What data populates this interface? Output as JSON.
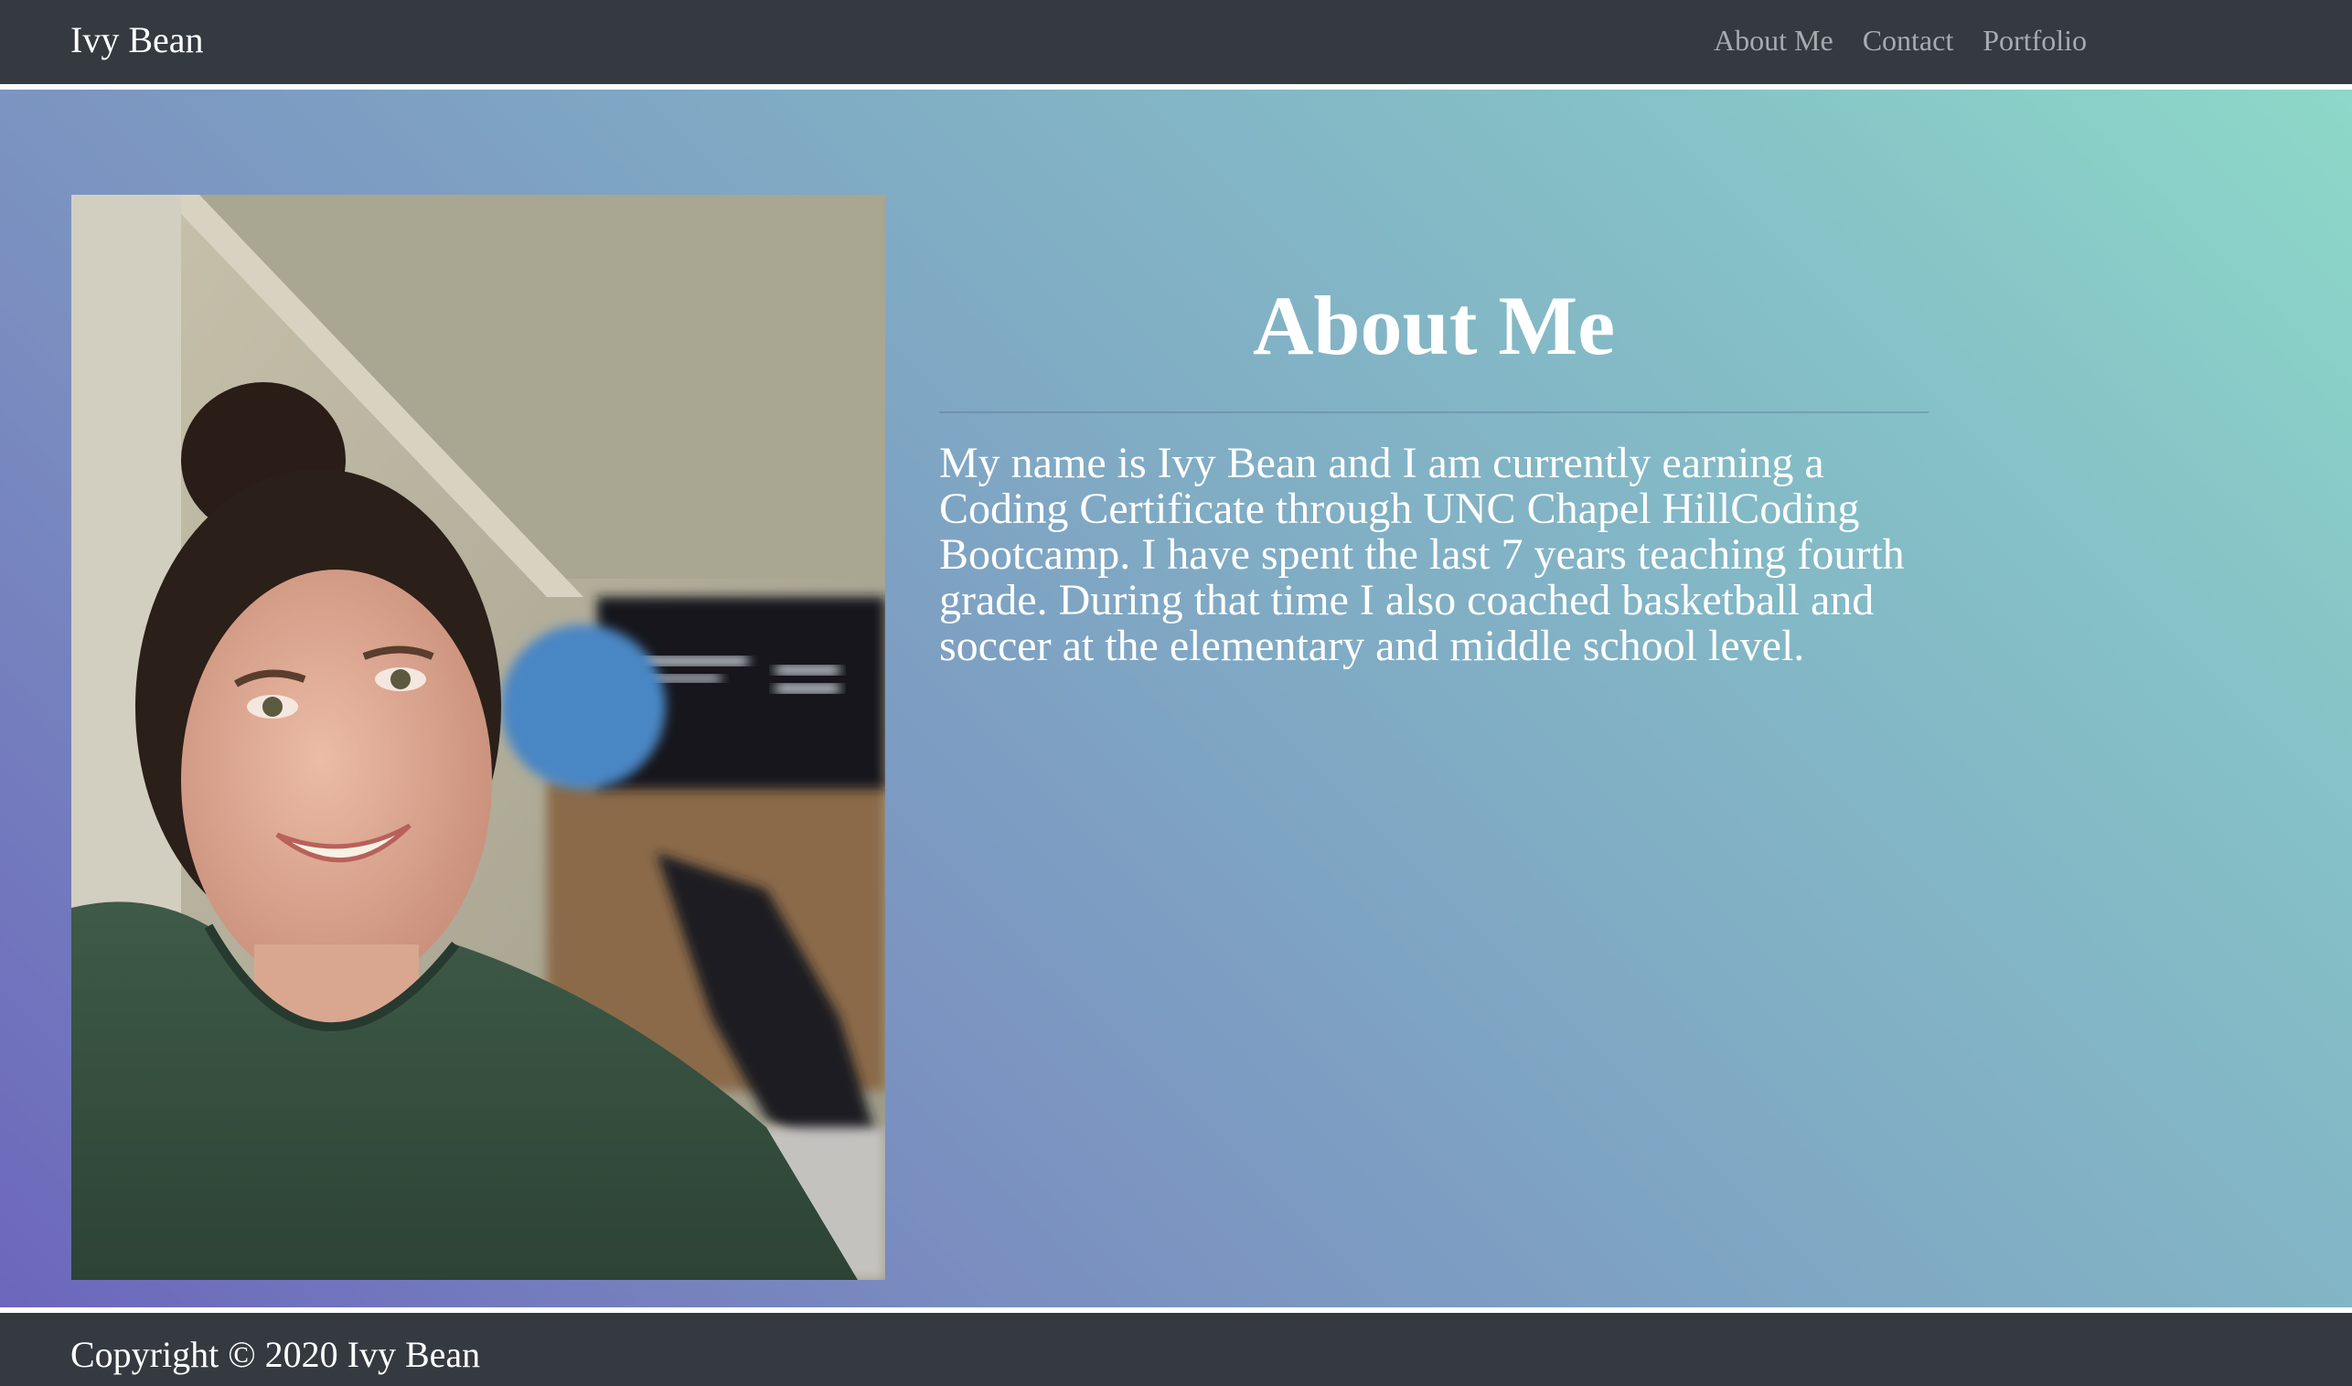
{
  "navbar": {
    "brand": "Ivy Bean",
    "links": [
      "About Me",
      "Contact",
      "Portfolio"
    ]
  },
  "about": {
    "title": "About Me",
    "body": "My name is Ivy Bean and I am currently earning a Coding Certificate through UNC Chapel HillCoding Bootcamp. I have spent the last 7 years teaching fourth grade. During that time I also coached basketball and soccer at the elementary and middle school level.",
    "photo_description": "photo-portrait"
  },
  "footer": {
    "copyright": "Copyright © 2020 Ivy Bean"
  },
  "colors": {
    "navbar_bg": "#343a40",
    "nav_link": "#a8abae",
    "gradient_start": "#6b63bb",
    "gradient_end": "#8edbc8",
    "text": "#ffffff"
  }
}
